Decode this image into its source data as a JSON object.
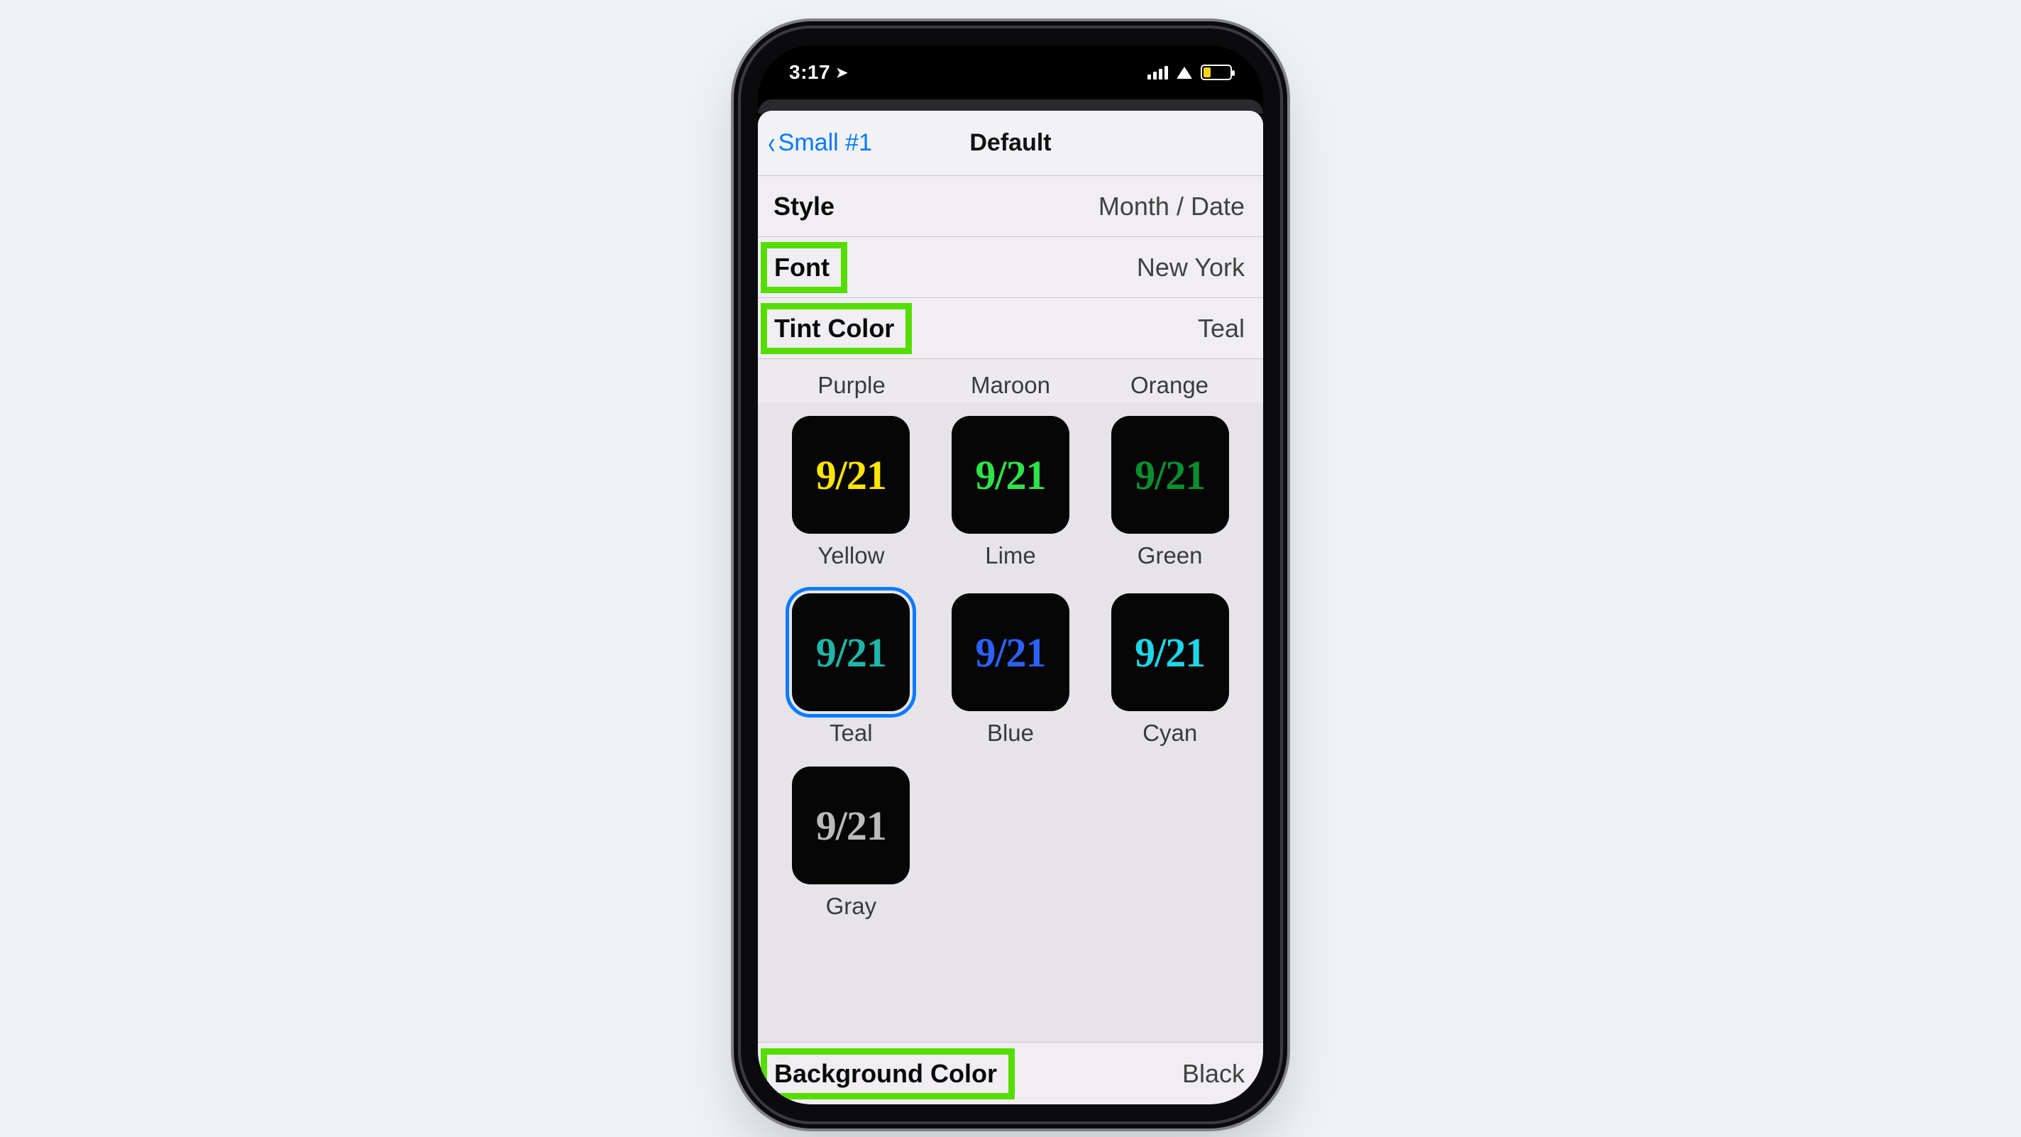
{
  "status": {
    "time": "3:17",
    "location_arrow": "➤"
  },
  "nav": {
    "back_label": "Small #1",
    "title": "Default"
  },
  "rows": {
    "style": {
      "label": "Style",
      "value": "Month / Date"
    },
    "font": {
      "label": "Font",
      "value": "New York"
    },
    "tint": {
      "label": "Tint Color",
      "value": "Teal"
    },
    "bg": {
      "label": "Background Color",
      "value": "Black"
    }
  },
  "sample_text": "9/21",
  "label_row": [
    "Purple",
    "Maroon",
    "Orange"
  ],
  "tint_options": [
    {
      "label": "Yellow",
      "color": "#ffe500",
      "selected": false
    },
    {
      "label": "Lime",
      "color": "#2fe24a",
      "selected": false
    },
    {
      "label": "Green",
      "color": "#0b8f2e",
      "selected": false
    },
    {
      "label": "Teal",
      "color": "#1fb5a8",
      "selected": true
    },
    {
      "label": "Blue",
      "color": "#2b62ff",
      "selected": false
    },
    {
      "label": "Cyan",
      "color": "#1fd6e6",
      "selected": false
    }
  ],
  "extra_option": {
    "label": "Gray",
    "color": "#bbbbbb"
  },
  "highlights": [
    "font",
    "tint",
    "bg"
  ],
  "colors": {
    "page_bg": "#eef2f5",
    "ios_blue": "#007aff",
    "highlight": "#55dd00"
  }
}
